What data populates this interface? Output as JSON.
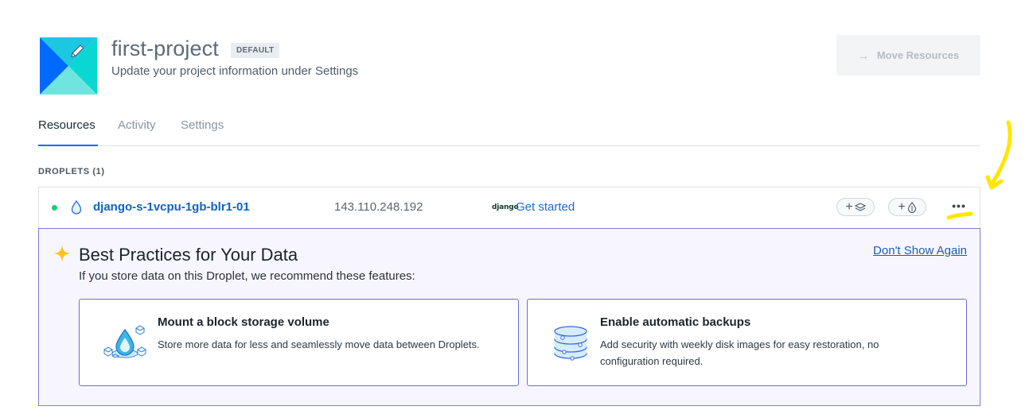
{
  "project": {
    "name": "first-project",
    "badge": "DEFAULT",
    "subtitle": "Update your project information under Settings",
    "move_button": "Move Resources",
    "logo_icon": "project-logo-pencil-icon"
  },
  "tabs": [
    {
      "label": "Resources",
      "active": true
    },
    {
      "label": "Activity",
      "active": false
    },
    {
      "label": "Settings",
      "active": false
    }
  ],
  "droplets_section": {
    "label": "DROPLETS (1)",
    "items": [
      {
        "name": "django-s-1vcpu-1gb-blr1-01",
        "ip": "143.110.248.192",
        "status": "active",
        "status_color": "#15cd72",
        "app_logo": "django",
        "app_action": "Get started",
        "add_volume": "+",
        "add_backup": "+"
      }
    ]
  },
  "best_practices": {
    "title": "Best Practices for Your Data",
    "subtitle": "If you store data on this Droplet, we recommend these features:",
    "dismiss": "Don't Show Again",
    "cards": [
      {
        "title": "Mount a block storage volume",
        "description": "Store more data for less and seamlessly move data between Droplets.",
        "icon": "block-storage-icon"
      },
      {
        "title": "Enable automatic backups",
        "description": "Add security with weekly disk images for easy restoration, no configuration required.",
        "icon": "backup-disks-icon"
      }
    ]
  },
  "colors": {
    "accent": "#0069ff",
    "link": "#1a6cc9",
    "panel_border": "#7c7fd6",
    "annotation": "#ffe600"
  }
}
